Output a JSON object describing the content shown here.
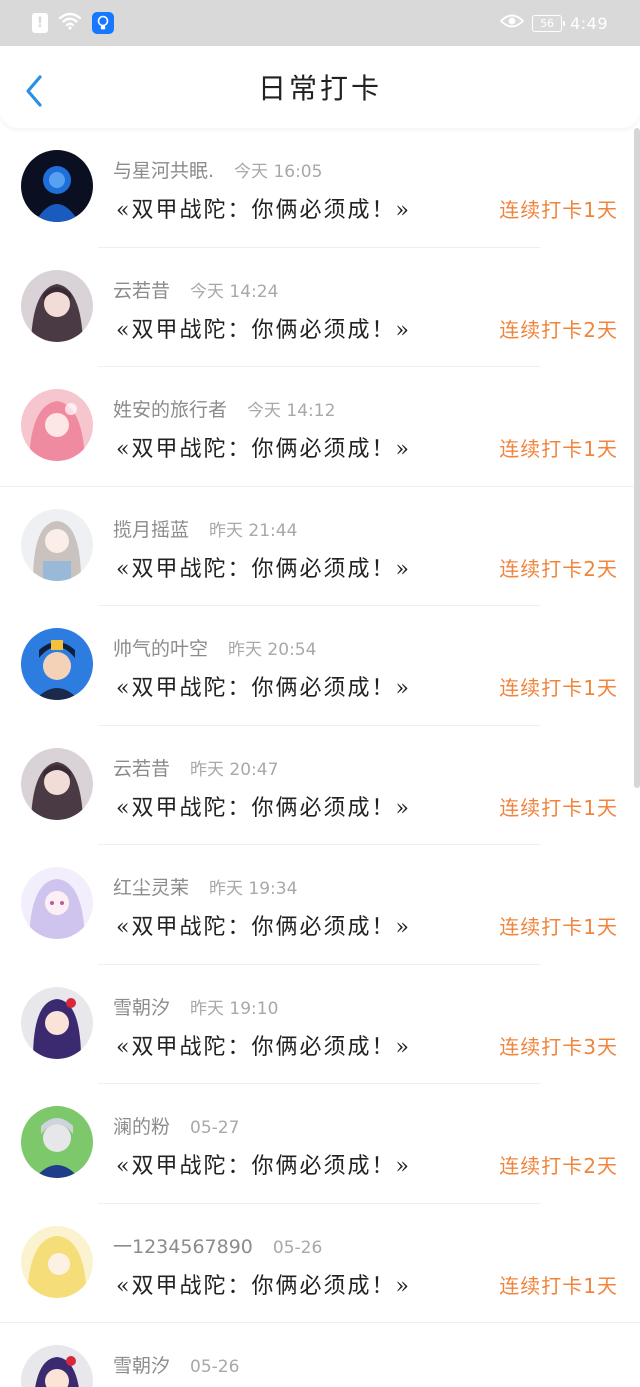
{
  "status_bar": {
    "alert_glyph": "!",
    "battery": "56",
    "time": "4:49"
  },
  "header": {
    "title": "日常打卡"
  },
  "colors": {
    "streak": "#f0843c",
    "back_arrow": "#2b8fe8",
    "status_bar_bg": "#d9d9d9"
  },
  "checkins": [
    {
      "name": "与星河共眠.",
      "time": "今天 16:05",
      "quest": "«双甲战陀：你俩必须成！»",
      "streak": "连续打卡1天",
      "avatar": "blue-silhouette"
    },
    {
      "name": "云若昔",
      "time": "今天 14:24",
      "quest": "«双甲战陀：你俩必须成！»",
      "streak": "连续打卡2天",
      "avatar": "anime-girl-dark"
    },
    {
      "name": "姓安的旅行者",
      "time": "今天 14:12",
      "quest": "«双甲战陀：你俩必须成！»",
      "streak": "连续打卡1天",
      "avatar": "anime-girl-pink"
    },
    {
      "name": "揽月摇蓝",
      "time": "昨天 21:44",
      "quest": "«双甲战陀：你俩必须成！»",
      "streak": "连续打卡2天",
      "avatar": "anime-girl-silver"
    },
    {
      "name": "帅气的叶空",
      "time": "昨天 20:54",
      "quest": "«双甲战陀：你俩必须成！»",
      "streak": "连续打卡1天",
      "avatar": "boy-cap"
    },
    {
      "name": "云若昔",
      "time": "昨天 20:47",
      "quest": "«双甲战陀：你俩必须成！»",
      "streak": "连续打卡1天",
      "avatar": "anime-girl-dark"
    },
    {
      "name": "红尘灵茉",
      "time": "昨天 19:34",
      "quest": "«双甲战陀：你俩必须成！»",
      "streak": "连续打卡1天",
      "avatar": "anime-girl-lilac"
    },
    {
      "name": "雪朝汐",
      "time": "昨天 19:10",
      "quest": "«双甲战陀：你俩必须成！»",
      "streak": "连续打卡3天",
      "avatar": "anime-girl-purple"
    },
    {
      "name": "澜的粉",
      "time": "05-27",
      "quest": "«双甲战陀：你俩必须成！»",
      "streak": "连续打卡2天",
      "avatar": "game-character"
    },
    {
      "name": "一1234567890",
      "time": "05-26",
      "quest": "«双甲战陀：你俩必须成！»",
      "streak": "连续打卡1天",
      "avatar": "anime-girl-blonde"
    },
    {
      "name": "雪朝汐",
      "time": "05-26",
      "quest": "",
      "streak": "",
      "avatar": "anime-girl-purple"
    }
  ]
}
